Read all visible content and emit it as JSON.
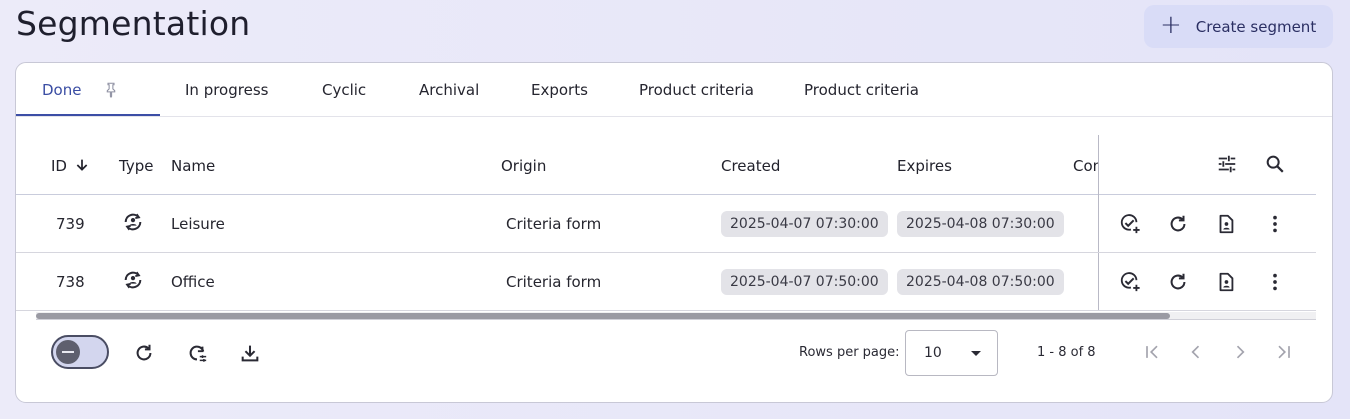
{
  "page": {
    "title": "Segmentation"
  },
  "header": {
    "create_label": "Create segment",
    "create_icon": "plus-icon"
  },
  "tabs": [
    {
      "label": "Done",
      "active": true,
      "pinned": true
    },
    {
      "label": "In progress"
    },
    {
      "label": "Cyclic"
    },
    {
      "label": "Archival"
    },
    {
      "label": "Exports"
    },
    {
      "label": "Product criteria"
    },
    {
      "label": "Product criteria"
    }
  ],
  "table": {
    "columns": {
      "id": "ID",
      "type": "Type",
      "name": "Name",
      "origin": "Origin",
      "created": "Created",
      "expires": "Expires",
      "extra": "Con"
    },
    "sort": {
      "column": "ID",
      "direction": "desc"
    },
    "header_icons": [
      "tune-icon",
      "search-icon"
    ],
    "rows": [
      {
        "id": "739",
        "type_icon": "sync-person-icon",
        "name": "Leisure",
        "origin": "Criteria form",
        "created": "2025-04-07 07:30:00",
        "expires": "2025-04-08 07:30:00"
      },
      {
        "id": "738",
        "type_icon": "sync-person-icon",
        "name": "Office",
        "origin": "Criteria form",
        "created": "2025-04-07 07:50:00",
        "expires": "2025-04-08 07:50:00"
      }
    ],
    "row_actions": [
      "approve-add-icon",
      "refresh-icon",
      "document-person-icon",
      "more-vertical-icon"
    ]
  },
  "footer": {
    "toggle_on": false,
    "actions": [
      "refresh-icon",
      "refresh-settings-icon",
      "download-icon"
    ],
    "rows_per_page_label": "Rows per page:",
    "rows_per_page_value": "10",
    "range_text": "1 - 8 of 8",
    "pagination_icons": [
      "first-page-icon",
      "prev-page-icon",
      "next-page-icon",
      "last-page-icon"
    ]
  },
  "colors": {
    "accent": "#3c4ea6",
    "button_bg": "#d9dcf7",
    "chip_bg": "#e3e3e8"
  }
}
